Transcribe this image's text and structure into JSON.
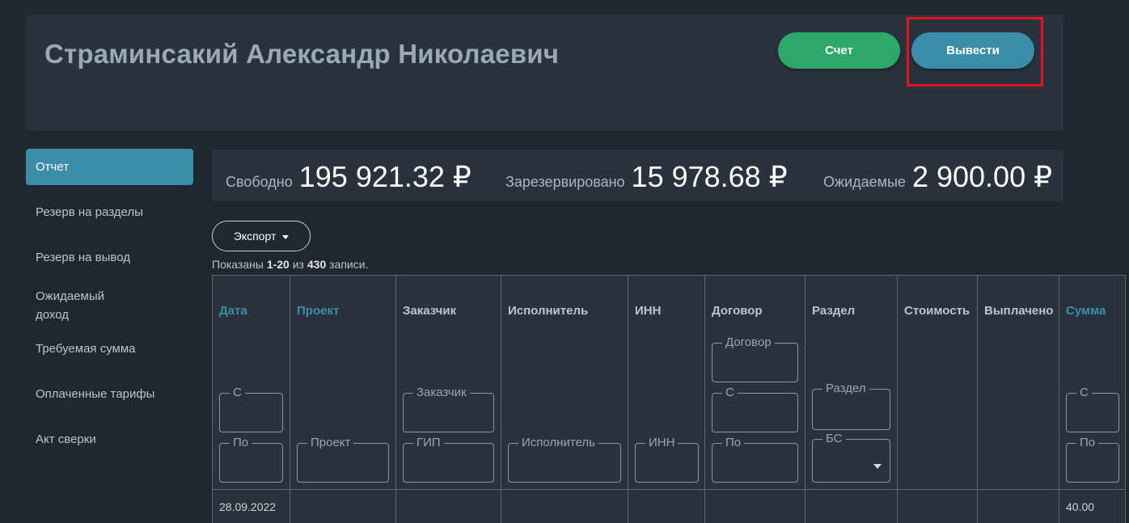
{
  "header": {
    "title": "Страминсакий Александр Николаевич",
    "schet_label": "Счет",
    "vyvesti_label": "Вывести"
  },
  "sidebar": {
    "items": [
      {
        "label": "Отчет"
      },
      {
        "label": "Резерв на разделы"
      },
      {
        "label": "Резерв на вывод"
      },
      {
        "label": "Ожидаемый доход"
      },
      {
        "label": "Требуемая сумма"
      },
      {
        "label": "Оплаченные тарифы"
      },
      {
        "label": "Акт сверки"
      }
    ]
  },
  "stats": {
    "free_label": "Свободно",
    "free_value": "195 921.32 ₽",
    "reserved_label": "Зарезервировано",
    "reserved_value": "15 978.68 ₽",
    "expected_label": "Ожидаемые",
    "expected_value": "2 900.00 ₽"
  },
  "toolbar": {
    "export_label": "Экспорт"
  },
  "summary": {
    "prefix": "Показаны",
    "range": "1-20",
    "of": "из",
    "total": "430",
    "suffix": "записи."
  },
  "table": {
    "columns": {
      "date": "Дата",
      "project": "Проект",
      "customer": "Заказчик",
      "executor": "Исполнитель",
      "inn": "ИНН",
      "contract": "Договор",
      "section": "Раздел",
      "cost": "Стоимость",
      "paid": "Выплачено",
      "amount": "Сумма"
    },
    "filters": {
      "from": "С",
      "to": "По",
      "project": "Проект",
      "customer": "Заказчик",
      "gip": "ГИП",
      "executor": "Исполнитель",
      "inn": "ИНН",
      "contract": "Договор",
      "section": "Раздел",
      "bs": "БС"
    },
    "rows": [
      {
        "date": "28.09.2022",
        "amount": "40.00"
      }
    ]
  },
  "colors": {
    "background": "#1f2830",
    "card": "#2a333d",
    "accent": "#3a8eaa",
    "green": "#2ea86a",
    "highlight": "#e3141b"
  }
}
